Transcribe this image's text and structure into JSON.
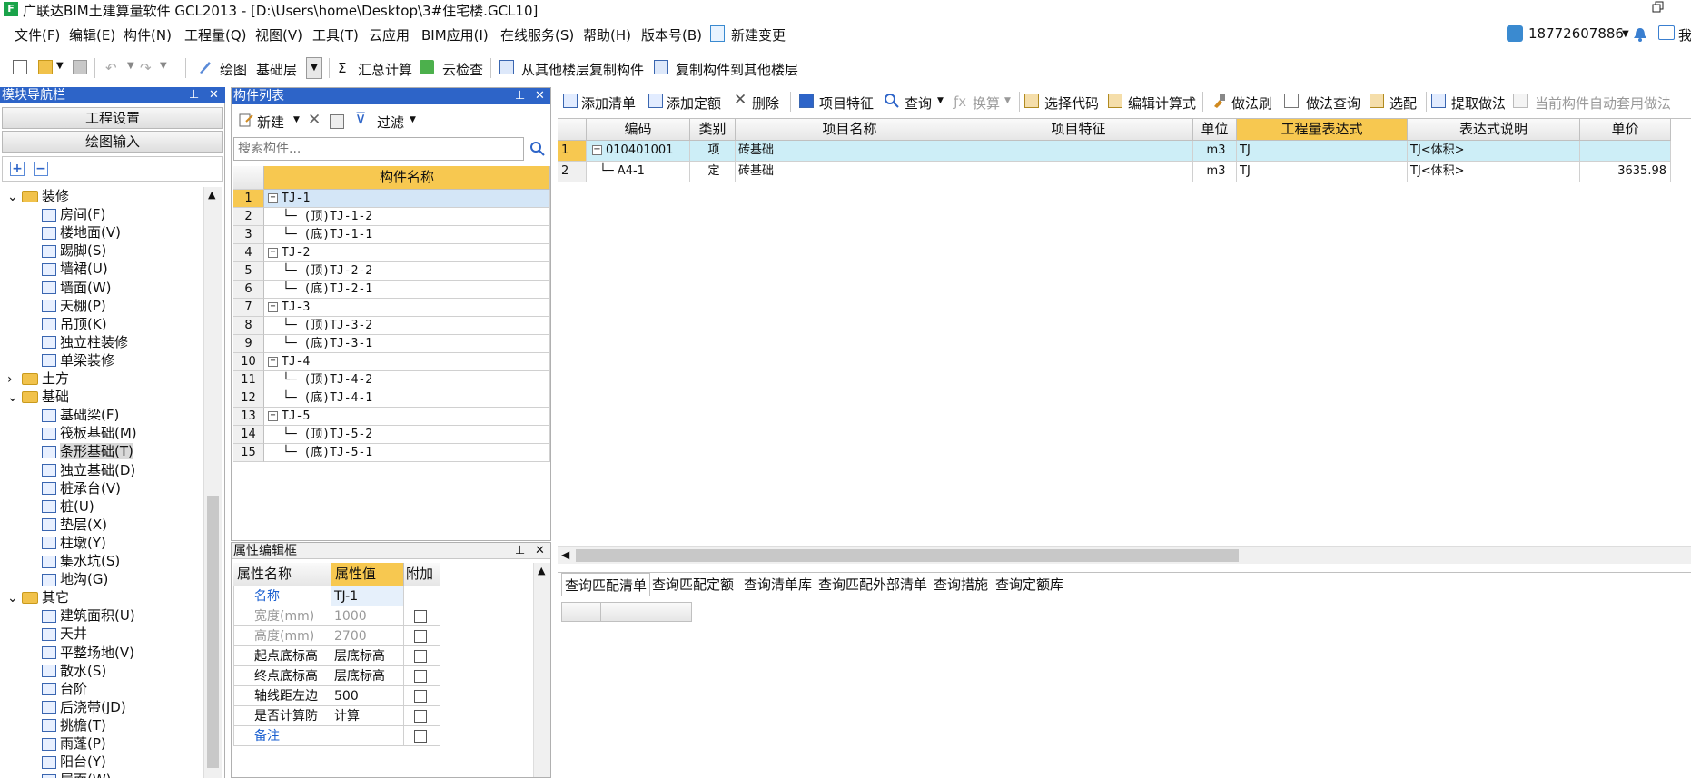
{
  "window": {
    "title": "广联达BIM土建算量软件 GCL2013 - [D:\\Users\\home\\Desktop\\3#住宅楼.GCL10]",
    "user": "18772607886",
    "user_extra": "我"
  },
  "menu": [
    "文件(F)",
    "编辑(E)",
    "构件(N)",
    "工程量(Q)",
    "视图(V)",
    "工具(T)",
    "云应用",
    "BIM应用(I)",
    "在线服务(S)",
    "帮助(H)",
    "版本号(B)",
    "新建变更"
  ],
  "toolbar1": {
    "draw": "绘图",
    "layer": "基础层",
    "sum": "汇总计算",
    "cloud_check": "云检查",
    "copy_from": "从其他楼层复制构件",
    "copy_to": "复制构件到其他楼层"
  },
  "nav": {
    "title": "模块导航栏",
    "btn_project": "工程设置",
    "btn_draw": "绘图输入",
    "tree": [
      {
        "label": "装修",
        "type": "folder",
        "expanded": true
      },
      {
        "label": "房间(F)",
        "type": "item"
      },
      {
        "label": "楼地面(V)",
        "type": "item"
      },
      {
        "label": "踢脚(S)",
        "type": "item"
      },
      {
        "label": "墙裙(U)",
        "type": "item"
      },
      {
        "label": "墙面(W)",
        "type": "item"
      },
      {
        "label": "天棚(P)",
        "type": "item"
      },
      {
        "label": "吊顶(K)",
        "type": "item"
      },
      {
        "label": "独立柱装修",
        "type": "item"
      },
      {
        "label": "单梁装修",
        "type": "item"
      },
      {
        "label": "土方",
        "type": "folder",
        "expanded": false
      },
      {
        "label": "基础",
        "type": "folder",
        "expanded": true
      },
      {
        "label": "基础梁(F)",
        "type": "item"
      },
      {
        "label": "筏板基础(M)",
        "type": "item"
      },
      {
        "label": "条形基础(T)",
        "type": "item",
        "selected": true
      },
      {
        "label": "独立基础(D)",
        "type": "item"
      },
      {
        "label": "桩承台(V)",
        "type": "item"
      },
      {
        "label": "桩(U)",
        "type": "item"
      },
      {
        "label": "垫层(X)",
        "type": "item"
      },
      {
        "label": "柱墩(Y)",
        "type": "item"
      },
      {
        "label": "集水坑(S)",
        "type": "item"
      },
      {
        "label": "地沟(G)",
        "type": "item"
      },
      {
        "label": "其它",
        "type": "folder",
        "expanded": true
      },
      {
        "label": "建筑面积(U)",
        "type": "item"
      },
      {
        "label": "天井",
        "type": "item"
      },
      {
        "label": "平整场地(V)",
        "type": "item"
      },
      {
        "label": "散水(S)",
        "type": "item"
      },
      {
        "label": "台阶",
        "type": "item"
      },
      {
        "label": "后浇带(JD)",
        "type": "item"
      },
      {
        "label": "挑檐(T)",
        "type": "item"
      },
      {
        "label": "雨蓬(P)",
        "type": "item"
      },
      {
        "label": "阳台(Y)",
        "type": "item"
      },
      {
        "label": "屋面(W)",
        "type": "item"
      }
    ]
  },
  "comp_list": {
    "title": "构件列表",
    "new": "新建",
    "filter": "过滤",
    "search_placeholder": "搜索构件...",
    "col_name": "构件名称",
    "rows": [
      {
        "n": "1",
        "label": "TJ-1",
        "level": 0
      },
      {
        "n": "2",
        "label": "(顶)TJ-1-2",
        "level": 1
      },
      {
        "n": "3",
        "label": "(底)TJ-1-1",
        "level": 1
      },
      {
        "n": "4",
        "label": "TJ-2",
        "level": 0
      },
      {
        "n": "5",
        "label": "(顶)TJ-2-2",
        "level": 1
      },
      {
        "n": "6",
        "label": "(底)TJ-2-1",
        "level": 1
      },
      {
        "n": "7",
        "label": "TJ-3",
        "level": 0
      },
      {
        "n": "8",
        "label": "(顶)TJ-3-2",
        "level": 1
      },
      {
        "n": "9",
        "label": "(底)TJ-3-1",
        "level": 1
      },
      {
        "n": "10",
        "label": "TJ-4",
        "level": 0
      },
      {
        "n": "11",
        "label": "(顶)TJ-4-2",
        "level": 1
      },
      {
        "n": "12",
        "label": "(底)TJ-4-1",
        "level": 1
      },
      {
        "n": "13",
        "label": "TJ-5",
        "level": 0
      },
      {
        "n": "14",
        "label": "(顶)TJ-5-2",
        "level": 1
      },
      {
        "n": "15",
        "label": "(底)TJ-5-1",
        "level": 1
      }
    ]
  },
  "props": {
    "title": "属性编辑框",
    "col_name": "属性名称",
    "col_value": "属性值",
    "col_extra": "附加",
    "rows": [
      {
        "name": "名称",
        "value": "TJ-1",
        "blue": true,
        "gray": false,
        "check": false
      },
      {
        "name": "宽度(mm)",
        "value": "1000",
        "blue": false,
        "gray": true,
        "check": true
      },
      {
        "name": "高度(mm)",
        "value": "2700",
        "blue": false,
        "gray": true,
        "check": true
      },
      {
        "name": "起点底标高",
        "value": "层底标高",
        "blue": false,
        "gray": false,
        "check": true
      },
      {
        "name": "终点底标高",
        "value": "层底标高",
        "blue": false,
        "gray": false,
        "check": true
      },
      {
        "name": "轴线距左边",
        "value": "500",
        "blue": false,
        "gray": false,
        "check": true
      },
      {
        "name": "是否计算防",
        "value": "计算",
        "blue": false,
        "gray": false,
        "check": true
      },
      {
        "name": "备注",
        "value": "",
        "blue": true,
        "gray": false,
        "check": true
      }
    ]
  },
  "toolbar2": {
    "add_list": "添加清单",
    "add_quota": "添加定额",
    "delete": "删除",
    "item_feature": "项目特征",
    "query": "查询",
    "convert": "换算",
    "select_code": "选择代码",
    "edit_formula": "编辑计算式",
    "method_brush": "做法刷",
    "method_query": "做法查询",
    "match": "选配",
    "extract": "提取做法",
    "auto_apply": "当前构件自动套用做法"
  },
  "main_grid": {
    "headers": [
      "编码",
      "类别",
      "项目名称",
      "项目特征",
      "单位",
      "工程量表达式",
      "表达式说明",
      "单价"
    ],
    "rows": [
      {
        "n": "1",
        "code": "010401001",
        "type": "项",
        "name": "砖基础",
        "feature": "",
        "unit": "m3",
        "expr": "TJ",
        "desc": "TJ<体积>",
        "price": ""
      },
      {
        "n": "2",
        "code": "A4-1",
        "type": "定",
        "name": "砖基础",
        "feature": "",
        "unit": "m3",
        "expr": "TJ",
        "desc": "TJ<体积>",
        "price": "3635.98"
      }
    ]
  },
  "bottom_tabs": [
    "查询匹配清单",
    "查询匹配定额",
    "查询清单库",
    "查询匹配外部清单",
    "查询措施",
    "查询定额库"
  ],
  "colors": {
    "panel_header": "#2d64c8",
    "selected_row": "#cdeef7",
    "highlight_header": "#f7c850"
  }
}
